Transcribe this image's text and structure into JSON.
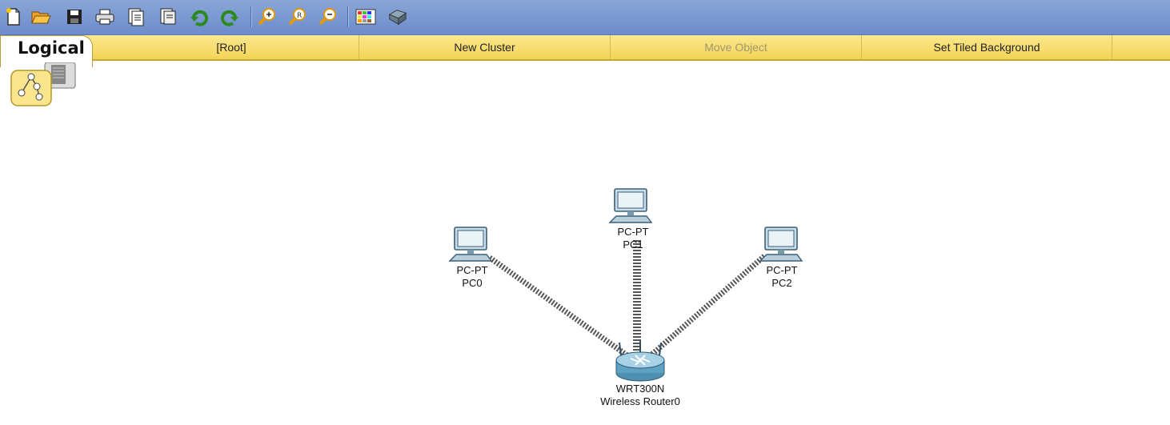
{
  "toolbar": {
    "icons": [
      "new-file-icon",
      "open-folder-icon",
      "save-icon",
      "print-icon",
      "activity-wizard-icon",
      "copy-icon",
      "undo-icon",
      "redo-icon",
      "zoom-in-icon",
      "zoom-reset-icon",
      "zoom-out-icon",
      "palette-icon",
      "custom-device-icon"
    ]
  },
  "workspace_bar": {
    "tab_label": "Logical",
    "root": "[Root]",
    "new_cluster": "New Cluster",
    "move_object": "Move Object",
    "set_tiled_background": "Set Tiled Background"
  },
  "devices": {
    "pc0": {
      "type": "PC-PT",
      "name": "PC0"
    },
    "pc1": {
      "type": "PC-PT",
      "name": "PC1"
    },
    "pc2": {
      "type": "PC-PT",
      "name": "PC2"
    },
    "router": {
      "type": "WRT300N",
      "name": "Wireless Router0"
    }
  },
  "colors": {
    "toolbar": "#7896d2",
    "workspace_bar": "#f6dc6c",
    "link": "#555555"
  }
}
